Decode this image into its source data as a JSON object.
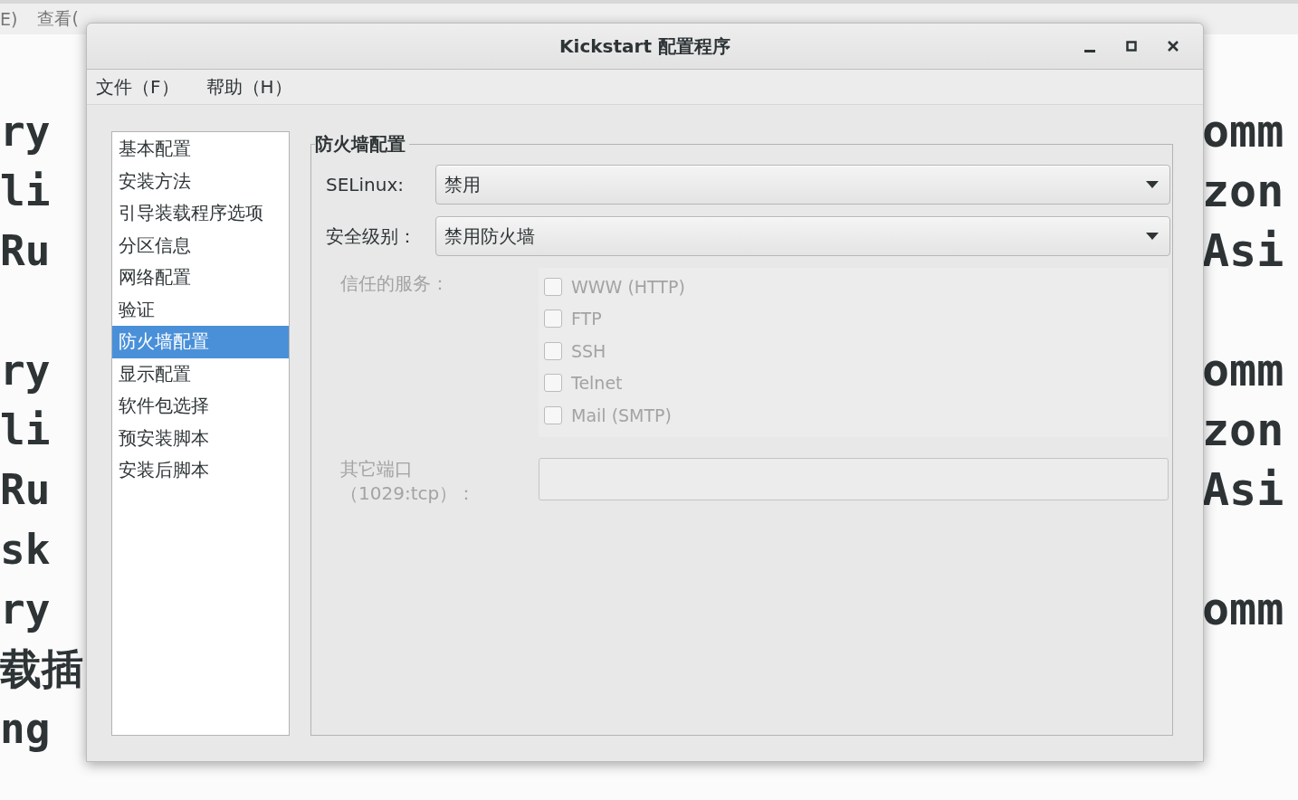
{
  "terminal": {
    "menu": [
      "E)",
      "查看("
    ],
    "left_blocks": [
      [
        "ry",
        "li",
        "Ru"
      ],
      [
        "ry",
        "li",
        "Ru",
        "sk",
        "ry",
        "载插",
        "ng"
      ]
    ],
    "right_blocks": [
      [
        "omm",
        "zon",
        "Asi"
      ],
      [
        "omm",
        "zon",
        "Asi"
      ],
      [
        "omm"
      ]
    ]
  },
  "window": {
    "title": "Kickstart 配置程序"
  },
  "menubar": [
    "文件（F）",
    "帮助（H）"
  ],
  "sidebar": {
    "items": [
      {
        "label": "基本配置",
        "selected": false
      },
      {
        "label": "安装方法",
        "selected": false
      },
      {
        "label": "引导装载程序选项",
        "selected": false
      },
      {
        "label": "分区信息",
        "selected": false
      },
      {
        "label": "网络配置",
        "selected": false
      },
      {
        "label": "验证",
        "selected": false
      },
      {
        "label": "防火墙配置",
        "selected": true
      },
      {
        "label": "显示配置",
        "selected": false
      },
      {
        "label": "软件包选择",
        "selected": false
      },
      {
        "label": "预安装脚本",
        "selected": false
      },
      {
        "label": "安装后脚本",
        "selected": false
      }
    ]
  },
  "panel": {
    "title": "防火墙配置",
    "selinux": {
      "label": "SELinux:",
      "value": "禁用"
    },
    "security_level": {
      "label": "安全级别：",
      "value": "禁用防火墙"
    },
    "trusted_services": {
      "label": "信任的服务：",
      "disabled": true,
      "items": [
        {
          "label": "WWW (HTTP)",
          "checked": false
        },
        {
          "label": "FTP",
          "checked": false
        },
        {
          "label": "SSH",
          "checked": false
        },
        {
          "label": "Telnet",
          "checked": false
        },
        {
          "label": "Mail (SMTP)",
          "checked": false
        }
      ]
    },
    "other_ports": {
      "label": "其它端口（1029:tcp）：",
      "disabled": true
    }
  }
}
